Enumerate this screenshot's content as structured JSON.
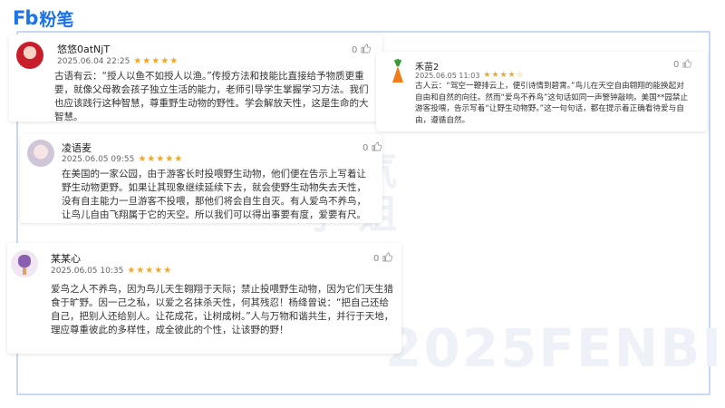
{
  "logo": {
    "mark": "Fb",
    "text": "粉笔"
  },
  "watermark": {
    "left": "挑 气\n学 姐",
    "year": "2025FENBI"
  },
  "comments": [
    {
      "user": "悠悠0atNjT",
      "date": "2025.06.04 22:25",
      "stars": "★★★★★",
      "likes": "0",
      "avatar_icon": "avatar-red-icon",
      "text": "古语有云：“授人以鱼不如授人以渔。”传授方法和技能比直接给予物质更重要，就像父母教会孩子独立生活的能力，老师引导学生掌握学习方法。我们也应该践行这种智慧，尊重野生动物的野性。学会解放天性，这是生命的大智慧。"
    },
    {
      "user": "禾苗2",
      "date": "2025.06.05 11:03",
      "stars": "★★★★☆",
      "likes": "0",
      "avatar_icon": "carrot-avatar-icon",
      "text": "古人云：“驾空一鞭排云上，便引诗情到碧霄。”鸟儿在天空自由翱翔的能换起对自由和自然的向往。然而“爱鸟不养鸟”这句话如同一声警钟敲响，美国**园禁止游客投喂，告示写着“让野生动物野。”这一句句话，都在提示着正确看待爱与自由，遵循自然。"
    },
    {
      "user": "凌语麦",
      "date": "2025.06.05 09:55",
      "stars": "★★★★★",
      "likes": "0",
      "avatar_icon": "avatar-girl-icon",
      "text": "在美国的一家公园，由于游客长时投喂野生动物，他们便在告示上写着让野生动物更野。如果让其现象继续延续下去，就会使野生动物失去天性，没有自主能力一旦游客不投喂，那他们将会自生自灭。有人爱鸟不养鸟，让鸟儿自由飞翔属于它的天空。所以我们可以得出事要有度，爱要有尺。"
    },
    {
      "user": "某某心",
      "date": "2025.06.05 10:35",
      "stars": "★★★★★",
      "likes": "0",
      "avatar_icon": "avatar-icecream-icon",
      "text": "爱鸟之人不养鸟，因为鸟儿天生翱翔于天际；禁止投喂野生动物，因为它们天生猎食于旷野。因一己之私，以爱之名抹杀天性，何其残忍！杨绛曾说：“把自己还给自己，把别人还给别人。让花成花，让树成树。”人与万物和谐共生，并行于天地，理应尊重彼此的多样性，成全彼此的个性，让该野的野！"
    }
  ],
  "colors": {
    "brand": "#1a73e8",
    "star": "#f5a623",
    "frame": "#c8d8f2"
  }
}
